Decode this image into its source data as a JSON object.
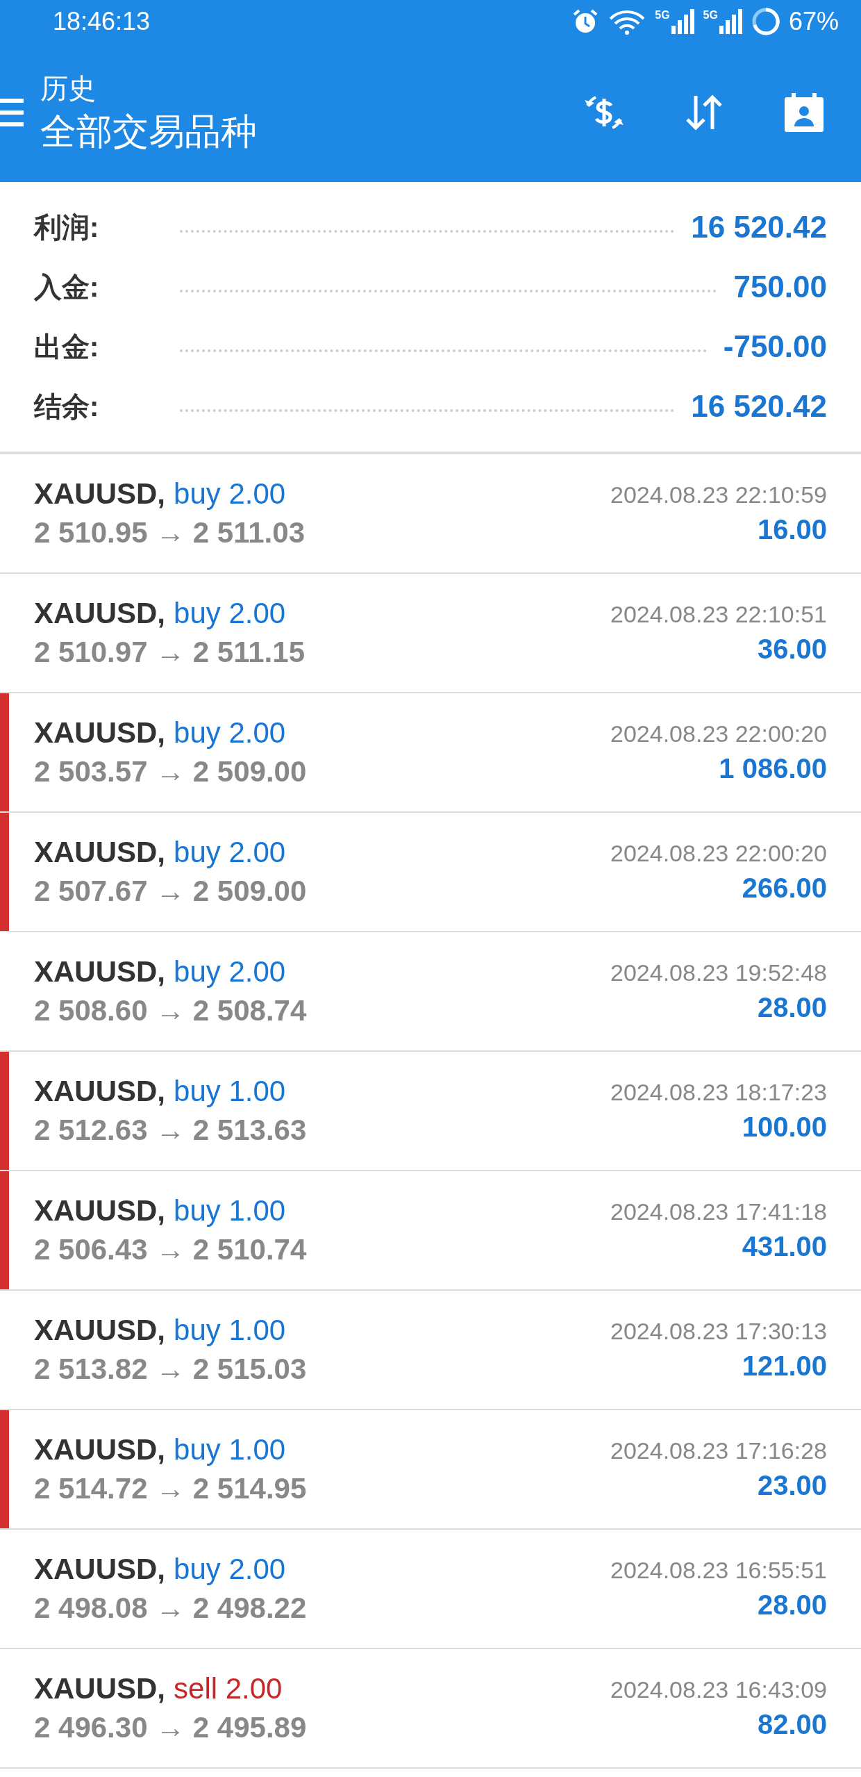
{
  "status_bar": {
    "time": "18:46:13",
    "network_1": "5G",
    "network_2": "5G",
    "battery": "67%"
  },
  "header": {
    "title": "历史",
    "subtitle": "全部交易品种"
  },
  "summary": [
    {
      "label": "利润:",
      "value": "16 520.42"
    },
    {
      "label": "入金:",
      "value": "750.00"
    },
    {
      "label": "出金:",
      "value": "-750.00"
    },
    {
      "label": "结余:",
      "value": "16 520.42"
    }
  ],
  "trades": [
    {
      "symbol": "XAUUSD,",
      "order": "buy 2.00",
      "kind": "buy",
      "prices": "2 510.95 → 2 511.03",
      "time": "2024.08.23 22:10:59",
      "profit": "16.00",
      "marked": false
    },
    {
      "symbol": "XAUUSD,",
      "order": "buy 2.00",
      "kind": "buy",
      "prices": "2 510.97 → 2 511.15",
      "time": "2024.08.23 22:10:51",
      "profit": "36.00",
      "marked": false
    },
    {
      "symbol": "XAUUSD,",
      "order": "buy 2.00",
      "kind": "buy",
      "prices": "2 503.57 → 2 509.00",
      "time": "2024.08.23 22:00:20",
      "profit": "1 086.00",
      "marked": true
    },
    {
      "symbol": "XAUUSD,",
      "order": "buy 2.00",
      "kind": "buy",
      "prices": "2 507.67 → 2 509.00",
      "time": "2024.08.23 22:00:20",
      "profit": "266.00",
      "marked": true
    },
    {
      "symbol": "XAUUSD,",
      "order": "buy 2.00",
      "kind": "buy",
      "prices": "2 508.60 → 2 508.74",
      "time": "2024.08.23 19:52:48",
      "profit": "28.00",
      "marked": false
    },
    {
      "symbol": "XAUUSD,",
      "order": "buy 1.00",
      "kind": "buy",
      "prices": "2 512.63 → 2 513.63",
      "time": "2024.08.23 18:17:23",
      "profit": "100.00",
      "marked": true
    },
    {
      "symbol": "XAUUSD,",
      "order": "buy 1.00",
      "kind": "buy",
      "prices": "2 506.43 → 2 510.74",
      "time": "2024.08.23 17:41:18",
      "profit": "431.00",
      "marked": true
    },
    {
      "symbol": "XAUUSD,",
      "order": "buy 1.00",
      "kind": "buy",
      "prices": "2 513.82 → 2 515.03",
      "time": "2024.08.23 17:30:13",
      "profit": "121.00",
      "marked": false
    },
    {
      "symbol": "XAUUSD,",
      "order": "buy 1.00",
      "kind": "buy",
      "prices": "2 514.72 → 2 514.95",
      "time": "2024.08.23 17:16:28",
      "profit": "23.00",
      "marked": true
    },
    {
      "symbol": "XAUUSD,",
      "order": "buy 2.00",
      "kind": "buy",
      "prices": "2 498.08 → 2 498.22",
      "time": "2024.08.23 16:55:51",
      "profit": "28.00",
      "marked": false
    },
    {
      "symbol": "XAUUSD,",
      "order": "sell 2.00",
      "kind": "sell",
      "prices": "2 496.30 → 2 495.89",
      "time": "2024.08.23 16:43:09",
      "profit": "82.00",
      "marked": false
    }
  ]
}
